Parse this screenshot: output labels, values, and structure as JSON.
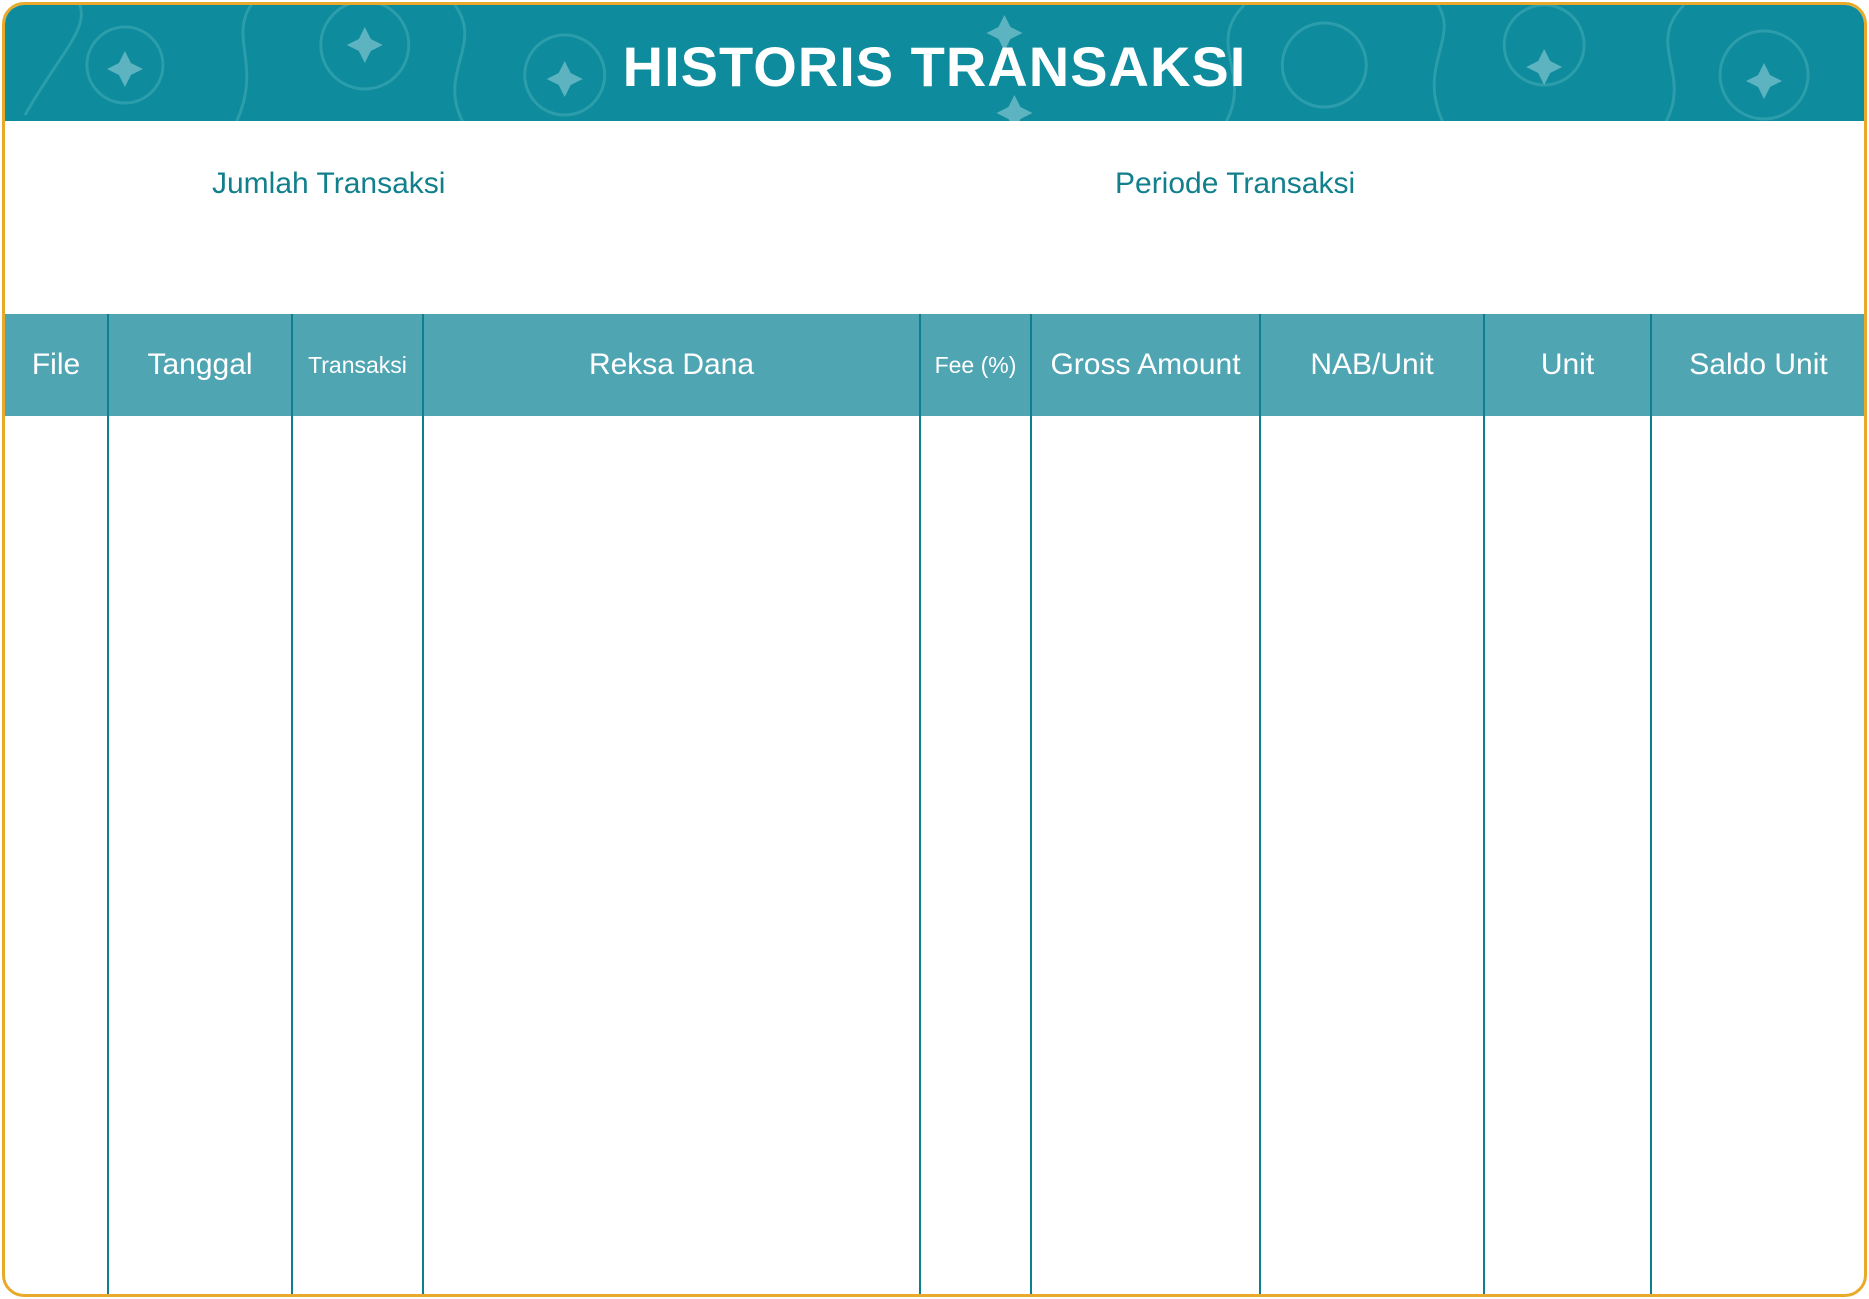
{
  "header": {
    "title": "HISTORIS TRANSAKSI"
  },
  "summary": {
    "jumlah_label": "Jumlah Transaksi",
    "periode_label": "Periode Transaksi"
  },
  "table": {
    "columns": [
      {
        "key": "file",
        "label": "File"
      },
      {
        "key": "tanggal",
        "label": "Tanggal"
      },
      {
        "key": "transaksi",
        "label": "Transaksi"
      },
      {
        "key": "reksa_dana",
        "label": "Reksa Dana"
      },
      {
        "key": "fee",
        "label": "Fee (%)"
      },
      {
        "key": "gross_amount",
        "label": "Gross Amount"
      },
      {
        "key": "nab_unit",
        "label": "NAB/Unit"
      },
      {
        "key": "unit",
        "label": "Unit"
      },
      {
        "key": "saldo_unit",
        "label": "Saldo Unit"
      }
    ],
    "rows": []
  },
  "colors": {
    "banner": "#0e8b9c",
    "header_row": "#50a5b3",
    "divider": "#0e7f8d",
    "label_text": "#117f8c",
    "frame_border": "#e9aa2b"
  }
}
